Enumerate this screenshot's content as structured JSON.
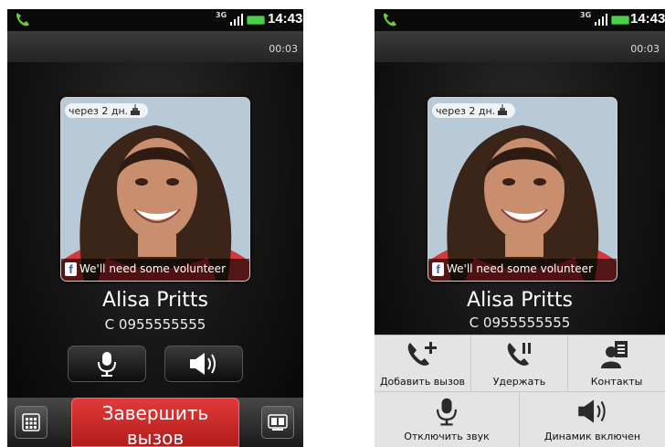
{
  "status": {
    "network": "3G",
    "time": "14:43"
  },
  "call": {
    "timer": "00:03",
    "reminder": "через 2 дн.",
    "facebook_status": "We'll need some volunteer",
    "facebook_letter": "f",
    "caller_name": "Alisa Pritts",
    "caller_number": "C 0955555555"
  },
  "bottom": {
    "end_call_line1": "Завершить",
    "end_call_line2": "вызов"
  },
  "menu": {
    "add_call": "Добавить вызов",
    "hold": "Удержать",
    "contacts": "Контакты",
    "mute": "Отключить звук",
    "speaker": "Динамик включен"
  },
  "colors": {
    "end_call": "#c62828",
    "battery": "#4cd04c",
    "status_phone": "#6cc83c"
  },
  "icons": [
    "phone-icon",
    "signal-icon",
    "battery-icon",
    "microphone-icon",
    "speaker-icon",
    "dialpad-icon",
    "car-kit-icon",
    "add-call-icon",
    "hold-icon",
    "contacts-icon",
    "facebook-icon"
  ]
}
